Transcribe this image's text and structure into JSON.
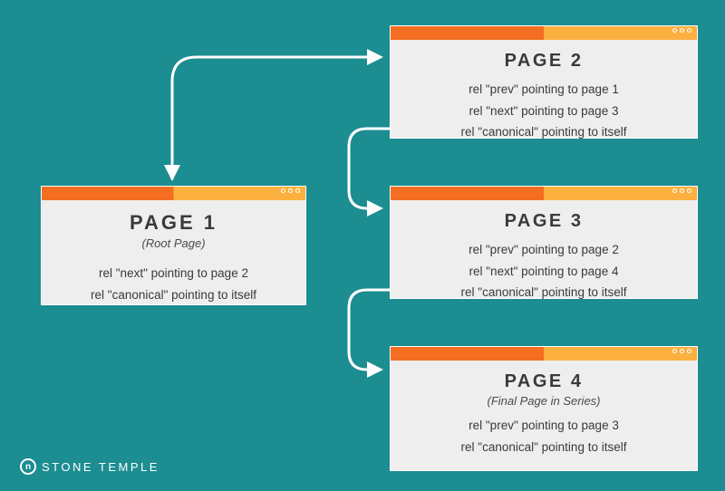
{
  "card1": {
    "title": "PAGE 1",
    "subtitle": "(Root Page)",
    "lines": [
      "rel \"next\" pointing to page 2",
      "rel \"canonical\" pointing to itself"
    ]
  },
  "card2": {
    "title": "PAGE 2",
    "lines": [
      "rel \"prev\" pointing to page 1",
      "rel \"next\" pointing to page 3",
      "rel \"canonical\" pointing to itself"
    ]
  },
  "card3": {
    "title": "PAGE 3",
    "lines": [
      "rel \"prev\" pointing to page 2",
      "rel \"next\" pointing to page 4",
      "rel \"canonical\" pointing to itself"
    ]
  },
  "card4": {
    "title": "PAGE 4",
    "subtitle": "(Final Page in Series)",
    "lines": [
      "rel \"prev\" pointing to page 3",
      "rel \"canonical\" pointing to itself"
    ]
  },
  "logo": {
    "mark": "n",
    "text": "STONE TEMPLE"
  }
}
